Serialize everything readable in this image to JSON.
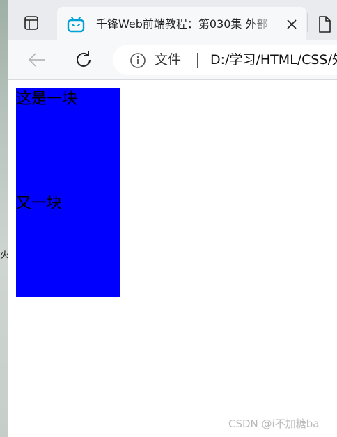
{
  "desktop": {
    "fragment_text": "火"
  },
  "browser": {
    "tabs": [
      {
        "title": "千锋Web前端教程：第030集 外部",
        "favicon": "bilibili-tv-icon",
        "active": true
      },
      {
        "title": "",
        "favicon": "document-icon",
        "active": false
      }
    ],
    "toolbar": {
      "back_icon": "arrow-left-icon",
      "reload_icon": "reload-icon",
      "info_icon": "info-circle-icon",
      "site_label": "文件",
      "url": "D:/学习/HTML/CSS/外"
    }
  },
  "page": {
    "blocks": [
      {
        "text": "这是一块",
        "color": "#0000ff"
      },
      {
        "text": "又一块",
        "color": "#0000ff"
      }
    ]
  },
  "watermark": "CSDN @i不加糖ba",
  "colors": {
    "tab_strip": "#e9ebee",
    "active_tab": "#f7f8f9",
    "toolbar": "#f7f8f9",
    "favicon_blue": "#00a1d6",
    "block_blue": "#0000ff"
  }
}
